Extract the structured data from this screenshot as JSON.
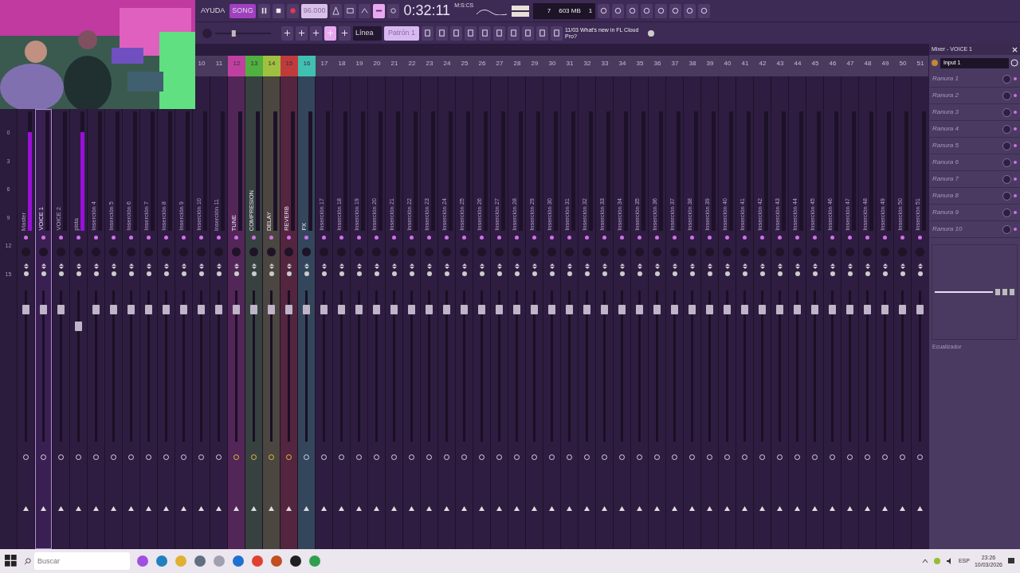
{
  "toolbar": {
    "help_menu": "AYUDA",
    "mode": {
      "label": "SONG",
      "selected": true
    },
    "tempo": "96.000",
    "time": "0:32:11",
    "time_format": "M:S:CS",
    "cpu_voices": "7",
    "memory": "603 MB",
    "polyphony": "1",
    "snap": "Línea",
    "pattern": "Patrón 1",
    "master_pitch": {
      "level": 0.32
    },
    "news": "11/03 What's new in FL Cloud Pro?"
  },
  "scale": [
    "0",
    "3",
    "6",
    "9",
    "12",
    "15"
  ],
  "tracks": [
    {
      "name": "Master",
      "selected": false,
      "routed": false,
      "meter": {
        "level": 0.83
      },
      "fader": {
        "level": 0.9
      }
    },
    {
      "name": "VOICE 1",
      "selected": true,
      "routed": false,
      "fader": {
        "level": 0.9
      }
    },
    {
      "name": "VOICE 2",
      "selected": false,
      "routed": false,
      "fader": {
        "level": 0.9
      }
    },
    {
      "name": "pista",
      "selected": false,
      "routed": false,
      "meter": {
        "level": 0.83
      },
      "fader": {
        "level": 0.78
      }
    },
    {
      "name": "Inserción 4",
      "selected": false,
      "routed": false,
      "fader": {
        "level": 0.9
      }
    },
    {
      "name": "Inserción 5",
      "selected": false,
      "routed": false,
      "fader": {
        "level": 0.9
      }
    },
    {
      "name": "Inserción 6",
      "selected": false,
      "routed": false,
      "fader": {
        "level": 0.9
      }
    },
    {
      "name": "Inserción 7",
      "selected": false,
      "routed": false,
      "fader": {
        "level": 0.9
      }
    },
    {
      "name": "Inserción 8",
      "selected": false,
      "routed": false,
      "fader": {
        "level": 0.9
      }
    },
    {
      "name": "Inserción 9",
      "selected": false,
      "routed": false,
      "fader": {
        "level": 0.9
      }
    },
    {
      "number": "10",
      "name": "Inserción 10",
      "selected": false,
      "routed": false,
      "fader": {
        "level": 0.9
      }
    },
    {
      "number": "11",
      "name": "Inserción 11",
      "selected": false,
      "routed": false,
      "fader": {
        "level": 0.9
      }
    },
    {
      "number": "12",
      "name": "TUNE",
      "color": "#c040a0",
      "selected": false,
      "routed": true,
      "fader": {
        "level": 0.9
      }
    },
    {
      "number": "13",
      "name": "COMPRESION",
      "color": "#50b040",
      "selected": false,
      "routed": true,
      "fader": {
        "level": 0.9
      }
    },
    {
      "number": "14",
      "name": "DELAY",
      "color": "#a0c040",
      "selected": false,
      "routed": true,
      "fader": {
        "level": 0.9
      }
    },
    {
      "number": "15",
      "name": "REVERB",
      "color": "#c03c3c",
      "selected": false,
      "routed": true,
      "fader": {
        "level": 0.9
      }
    },
    {
      "number": "16",
      "name": "FX",
      "color": "#40c0b0",
      "selected": false,
      "routed": false,
      "fader": {
        "level": 0.9
      }
    },
    {
      "number": "17",
      "name": "Inserción 17",
      "selected": false,
      "routed": false,
      "fader": {
        "level": 0.9
      }
    },
    {
      "number": "18",
      "name": "Inserción 18",
      "selected": false,
      "routed": false,
      "fader": {
        "level": 0.9
      }
    },
    {
      "number": "19",
      "name": "Inserción 19",
      "selected": false,
      "routed": false,
      "fader": {
        "level": 0.9
      }
    },
    {
      "number": "20",
      "name": "Inserción 20",
      "selected": false,
      "routed": false,
      "fader": {
        "level": 0.9
      }
    },
    {
      "number": "21",
      "name": "Inserción 21",
      "selected": false,
      "routed": false,
      "fader": {
        "level": 0.9
      }
    },
    {
      "number": "22",
      "name": "Inserción 22",
      "selected": false,
      "routed": false,
      "fader": {
        "level": 0.9
      }
    },
    {
      "number": "23",
      "name": "Inserción 23",
      "selected": false,
      "routed": false,
      "fader": {
        "level": 0.9
      }
    },
    {
      "number": "24",
      "name": "Inserción 24",
      "selected": false,
      "routed": false,
      "fader": {
        "level": 0.9
      }
    },
    {
      "number": "25",
      "name": "Inserción 25",
      "selected": false,
      "routed": false,
      "fader": {
        "level": 0.9
      }
    },
    {
      "number": "26",
      "name": "Inserción 26",
      "selected": false,
      "routed": false,
      "fader": {
        "level": 0.9
      }
    },
    {
      "number": "27",
      "name": "Inserción 27",
      "selected": false,
      "routed": false,
      "fader": {
        "level": 0.9
      }
    },
    {
      "number": "28",
      "name": "Inserción 28",
      "selected": false,
      "routed": false,
      "fader": {
        "level": 0.9
      }
    },
    {
      "number": "29",
      "name": "Inserción 29",
      "selected": false,
      "routed": false,
      "fader": {
        "level": 0.9
      }
    },
    {
      "number": "30",
      "name": "Inserción 30",
      "selected": false,
      "routed": false,
      "fader": {
        "level": 0.9
      }
    },
    {
      "number": "31",
      "name": "Inserción 31",
      "selected": false,
      "routed": false,
      "fader": {
        "level": 0.9
      }
    },
    {
      "number": "32",
      "name": "Inserción 32",
      "selected": false,
      "routed": false,
      "fader": {
        "level": 0.9
      }
    },
    {
      "number": "33",
      "name": "Inserción 33",
      "selected": false,
      "routed": false,
      "fader": {
        "level": 0.9
      }
    },
    {
      "number": "34",
      "name": "Inserción 34",
      "selected": false,
      "routed": false,
      "fader": {
        "level": 0.9
      }
    },
    {
      "number": "35",
      "name": "Inserción 35",
      "selected": false,
      "routed": false,
      "fader": {
        "level": 0.9
      }
    },
    {
      "number": "36",
      "name": "Inserción 36",
      "selected": false,
      "routed": false,
      "fader": {
        "level": 0.9
      }
    },
    {
      "number": "37",
      "name": "Inserción 37",
      "selected": false,
      "routed": false,
      "fader": {
        "level": 0.9
      }
    },
    {
      "number": "38",
      "name": "Inserción 38",
      "selected": false,
      "routed": false,
      "fader": {
        "level": 0.9
      }
    },
    {
      "number": "39",
      "name": "Inserción 39",
      "selected": false,
      "routed": false,
      "fader": {
        "level": 0.9
      }
    },
    {
      "number": "40",
      "name": "Inserción 40",
      "selected": false,
      "routed": false,
      "fader": {
        "level": 0.9
      }
    },
    {
      "number": "41",
      "name": "Inserción 41",
      "selected": false,
      "routed": false,
      "fader": {
        "level": 0.9
      }
    },
    {
      "number": "42",
      "name": "Inserción 42",
      "selected": false,
      "routed": false,
      "fader": {
        "level": 0.9
      }
    },
    {
      "number": "43",
      "name": "Inserción 43",
      "selected": false,
      "routed": false,
      "fader": {
        "level": 0.9
      }
    },
    {
      "number": "44",
      "name": "Inserción 44",
      "selected": false,
      "routed": false,
      "fader": {
        "level": 0.9
      }
    },
    {
      "number": "45",
      "name": "Inserción 45",
      "selected": false,
      "routed": false,
      "fader": {
        "level": 0.9
      }
    },
    {
      "number": "46",
      "name": "Inserción 46",
      "selected": false,
      "routed": false,
      "fader": {
        "level": 0.9
      }
    },
    {
      "number": "47",
      "name": "Inserción 47",
      "selected": false,
      "routed": false,
      "fader": {
        "level": 0.9
      }
    },
    {
      "number": "48",
      "name": "Inserción 48",
      "selected": false,
      "routed": false,
      "fader": {
        "level": 0.9
      }
    },
    {
      "number": "49",
      "name": "Inserción 49",
      "selected": false,
      "routed": false,
      "fader": {
        "level": 0.9
      }
    },
    {
      "number": "50",
      "name": "Inserción 50",
      "selected": false,
      "routed": false,
      "fader": {
        "level": 0.9
      }
    },
    {
      "number": "51",
      "name": "Inserción 51",
      "selected": false,
      "routed": false,
      "fader": {
        "level": 0.9
      }
    }
  ],
  "panel": {
    "title": "Mixer - VOICE 1",
    "input": "Input 1",
    "slots": [
      "Ranura 1",
      "Ranura 2",
      "Ranura 3",
      "Ranura 4",
      "Ranura 5",
      "Ranura 6",
      "Ranura 7",
      "Ranura 8",
      "Ranura 9",
      "Ranura 10"
    ],
    "eq_label": "Ecualizador"
  },
  "taskbar": {
    "search_placeholder": "Buscar",
    "language": "ESP",
    "time": "23:26",
    "date": "10/03/2026"
  }
}
